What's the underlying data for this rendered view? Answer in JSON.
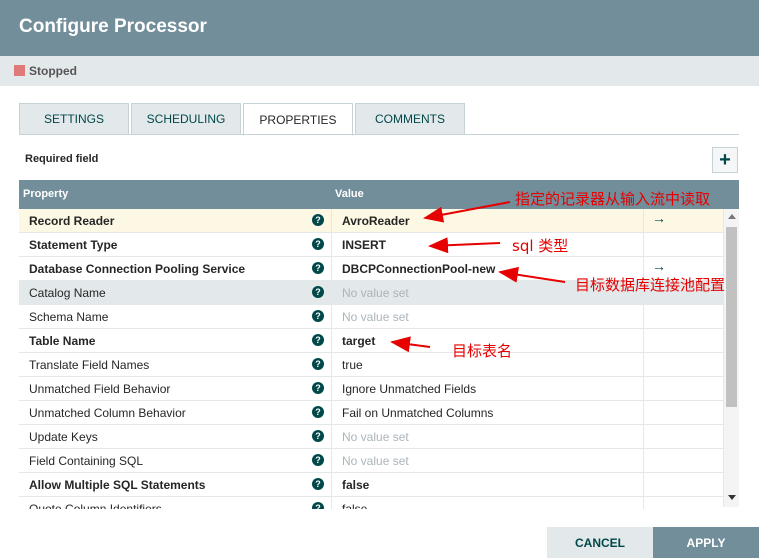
{
  "dialog": {
    "title": "Configure Processor"
  },
  "status": {
    "label": "Stopped",
    "color": "#e07a7a"
  },
  "tabs": [
    {
      "label": "SETTINGS",
      "active": false
    },
    {
      "label": "SCHEDULING",
      "active": false
    },
    {
      "label": "PROPERTIES",
      "active": true
    },
    {
      "label": "COMMENTS",
      "active": false
    }
  ],
  "properties": {
    "required_label": "Required field",
    "add_icon": "plus-icon",
    "add_glyph": "+",
    "header": {
      "property": "Property",
      "value": "Value"
    },
    "rows": [
      {
        "name": "Record Reader",
        "value": "AvroReader",
        "required": true,
        "no_value": false,
        "goto": true
      },
      {
        "name": "Statement Type",
        "value": "INSERT",
        "required": true,
        "no_value": false,
        "goto": false
      },
      {
        "name": "Database Connection Pooling Service",
        "value": "DBCPConnectionPool-new",
        "required": true,
        "no_value": false,
        "goto": true
      },
      {
        "name": "Catalog Name",
        "value": "No value set",
        "required": false,
        "no_value": true,
        "goto": false
      },
      {
        "name": "Schema Name",
        "value": "No value set",
        "required": false,
        "no_value": true,
        "goto": false
      },
      {
        "name": "Table Name",
        "value": "target",
        "required": true,
        "no_value": false,
        "goto": false
      },
      {
        "name": "Translate Field Names",
        "value": "true",
        "required": false,
        "no_value": false,
        "goto": false
      },
      {
        "name": "Unmatched Field Behavior",
        "value": "Ignore Unmatched Fields",
        "required": false,
        "no_value": false,
        "goto": false
      },
      {
        "name": "Unmatched Column Behavior",
        "value": "Fail on Unmatched Columns",
        "required": false,
        "no_value": false,
        "goto": false
      },
      {
        "name": "Update Keys",
        "value": "No value set",
        "required": false,
        "no_value": true,
        "goto": false
      },
      {
        "name": "Field Containing SQL",
        "value": "No value set",
        "required": false,
        "no_value": true,
        "goto": false
      },
      {
        "name": "Allow Multiple SQL Statements",
        "value": "false",
        "required": true,
        "no_value": false,
        "goto": false
      },
      {
        "name": "Quote Column Identifiers",
        "value": "false",
        "required": false,
        "no_value": false,
        "goto": false
      }
    ],
    "help_glyph": "?",
    "goto_glyph": "→"
  },
  "annotations": [
    "指定的记录器从输入流中读取",
    "sql 类型",
    "目标数据库连接池配置",
    "目标表名"
  ],
  "buttons": {
    "cancel": "CANCEL",
    "apply": "APPLY"
  }
}
